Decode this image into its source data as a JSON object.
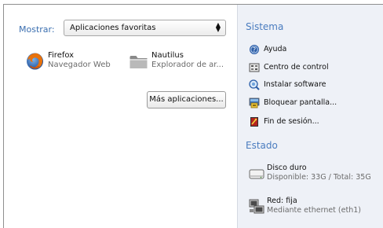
{
  "show": {
    "label": "Mostrar:",
    "selected": "Aplicaciones favoritas"
  },
  "apps": [
    {
      "title": "Firefox",
      "subtitle": "Navegador Web",
      "icon": "firefox-icon"
    },
    {
      "title": "Nautilus",
      "subtitle": "Explorador de ar...",
      "icon": "folder-icon"
    }
  ],
  "more_button": "Más aplicaciones...",
  "system": {
    "heading": "Sistema",
    "items": [
      {
        "label": "Ayuda",
        "icon": "help-icon"
      },
      {
        "label": "Centro de control",
        "icon": "control-center-icon"
      },
      {
        "label": "Instalar software",
        "icon": "install-software-icon"
      },
      {
        "label": "Bloquear pantalla...",
        "icon": "lock-screen-icon"
      },
      {
        "label": "Fin de sesión...",
        "icon": "logout-icon"
      }
    ]
  },
  "status": {
    "heading": "Estado",
    "items": [
      {
        "title": "Disco duro",
        "subtitle": "Disponible: 33G / Total: 35G",
        "icon": "hard-disk-icon"
      },
      {
        "title": "Red: fija",
        "subtitle": "Mediante ethernet (eth1)",
        "icon": "network-wired-icon"
      }
    ]
  },
  "colors": {
    "accent": "#4a7cbf",
    "right_pane": "#eef1f7"
  }
}
